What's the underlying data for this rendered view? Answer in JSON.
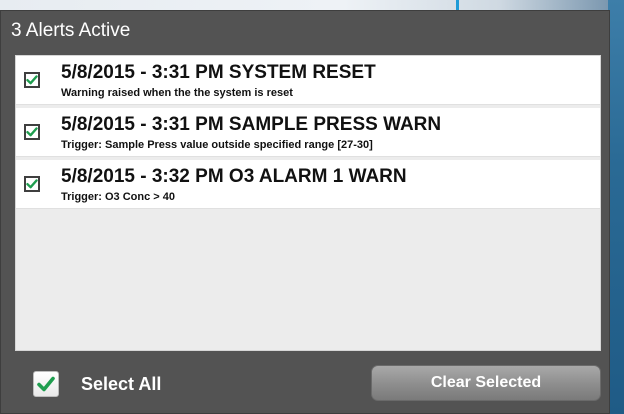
{
  "dialog": {
    "title": "3 Alerts Active"
  },
  "alerts": [
    {
      "title": "5/8/2015 - 3:31 PM SYSTEM RESET",
      "description": "Warning raised when the the system is reset",
      "checked": true,
      "icon": "checkmark-icon"
    },
    {
      "title": "5/8/2015 - 3:31 PM SAMPLE PRESS WARN",
      "description": "Trigger: Sample Press value outside specified range [27-30]",
      "checked": true,
      "icon": "checkmark-icon"
    },
    {
      "title": "5/8/2015 - 3:32 PM O3 ALARM 1 WARN",
      "description": "Trigger: O3 Conc > 40",
      "checked": true,
      "icon": "checkmark-icon"
    }
  ],
  "footer": {
    "select_all_label": "Select All",
    "select_all_checked": true,
    "clear_label": "Clear Selected"
  },
  "colors": {
    "dialog_bg": "#535353",
    "list_bg": "#ececec",
    "check_green": "#1f9e4f",
    "button_gray": "#8d8d8d",
    "accent_blue": "#1e9bd7"
  }
}
